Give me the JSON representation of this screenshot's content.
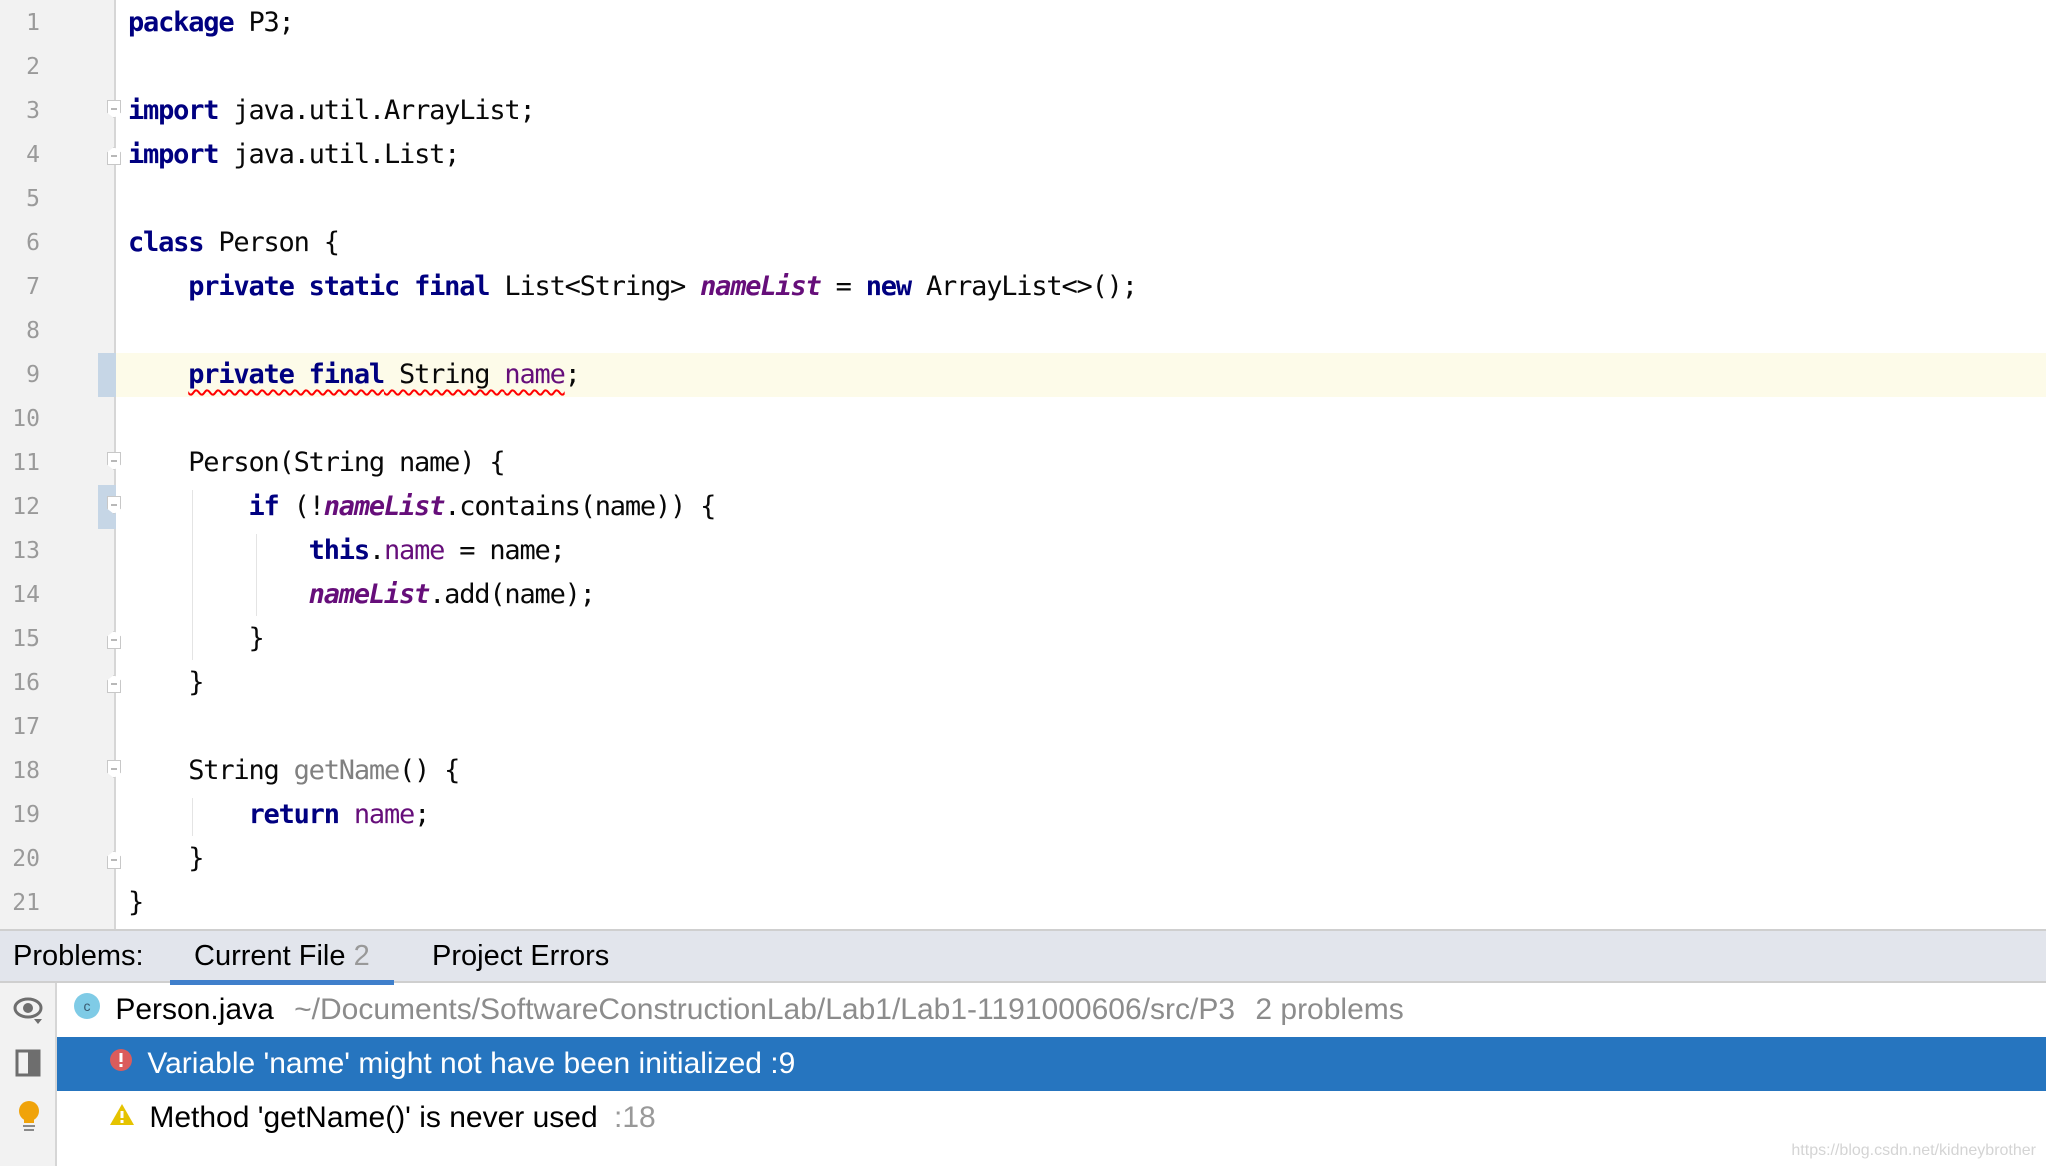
{
  "editor": {
    "current_line": 9,
    "lines": [
      {
        "n": "1",
        "tokens": [
          {
            "t": "package",
            "c": "kw"
          },
          {
            "t": " P3;"
          }
        ]
      },
      {
        "n": "2",
        "tokens": []
      },
      {
        "n": "3",
        "tokens": [
          {
            "t": "import",
            "c": "kw"
          },
          {
            "t": " java.util.ArrayList;"
          }
        ]
      },
      {
        "n": "4",
        "tokens": [
          {
            "t": "import",
            "c": "kw"
          },
          {
            "t": " java.util.List;"
          }
        ]
      },
      {
        "n": "5",
        "tokens": []
      },
      {
        "n": "6",
        "tokens": [
          {
            "t": "class",
            "c": "kw"
          },
          {
            "t": " Person {"
          }
        ]
      },
      {
        "n": "7",
        "tokens": [
          {
            "t": "    "
          },
          {
            "t": "private static final",
            "c": "kw"
          },
          {
            "t": " List<String> "
          },
          {
            "t": "nameList",
            "c": "sfld"
          },
          {
            "t": " = "
          },
          {
            "t": "new",
            "c": "kw"
          },
          {
            "t": " ArrayList<>();"
          }
        ]
      },
      {
        "n": "8",
        "tokens": []
      },
      {
        "n": "9",
        "tokens": [
          {
            "t": "    "
          },
          {
            "t": "private final",
            "c": "kw err"
          },
          {
            "t": " String ",
            "c": "err"
          },
          {
            "t": "name",
            "c": "fld err"
          },
          {
            "t": ";"
          }
        ]
      },
      {
        "n": "10",
        "tokens": []
      },
      {
        "n": "11",
        "tokens": [
          {
            "t": "    Person(String name) {"
          }
        ]
      },
      {
        "n": "12",
        "tokens": [
          {
            "t": "        "
          },
          {
            "t": "if",
            "c": "kw"
          },
          {
            "t": " (!"
          },
          {
            "t": "nameList",
            "c": "sfld"
          },
          {
            "t": ".contains(name)) {"
          }
        ]
      },
      {
        "n": "13",
        "tokens": [
          {
            "t": "            "
          },
          {
            "t": "this",
            "c": "kw"
          },
          {
            "t": "."
          },
          {
            "t": "name",
            "c": "fld"
          },
          {
            "t": " = name;"
          }
        ]
      },
      {
        "n": "14",
        "tokens": [
          {
            "t": "            "
          },
          {
            "t": "nameList",
            "c": "sfld"
          },
          {
            "t": ".add(name);"
          }
        ]
      },
      {
        "n": "15",
        "tokens": [
          {
            "t": "        }"
          }
        ]
      },
      {
        "n": "16",
        "tokens": [
          {
            "t": "    }"
          }
        ]
      },
      {
        "n": "17",
        "tokens": []
      },
      {
        "n": "18",
        "tokens": [
          {
            "t": "    String "
          },
          {
            "t": "getName",
            "c": "unused"
          },
          {
            "t": "() {"
          }
        ]
      },
      {
        "n": "19",
        "tokens": [
          {
            "t": "        "
          },
          {
            "t": "return",
            "c": "kw"
          },
          {
            "t": " "
          },
          {
            "t": "name",
            "c": "fld"
          },
          {
            "t": ";"
          }
        ]
      },
      {
        "n": "20",
        "tokens": [
          {
            "t": "    }"
          }
        ]
      },
      {
        "n": "21",
        "tokens": [
          {
            "t": "}"
          }
        ]
      }
    ]
  },
  "problems": {
    "label": "Problems:",
    "tabs": [
      {
        "label": "Current File",
        "count": "2",
        "active": true
      },
      {
        "label": "Project Errors",
        "count": "",
        "active": false
      }
    ],
    "file": {
      "name": "Person.java",
      "icon": "class-icon",
      "path": "~/Documents/SoftwareConstructionLab/Lab1/Lab1-1191000606/src/P3",
      "summary": "2 problems"
    },
    "items": [
      {
        "severity": "error",
        "icon": "error-icon",
        "message": "Variable 'name' might not have been initialized",
        "location": ":9",
        "selected": true
      },
      {
        "severity": "warning",
        "icon": "warning-icon",
        "message": "Method 'getName()' is never used",
        "location": ":18",
        "selected": false
      }
    ],
    "tools": [
      "eye-icon",
      "preview-panel-icon",
      "lightbulb-icon"
    ]
  },
  "colors": {
    "selection": "#2675bf",
    "tab_underline": "#3f7fcb",
    "keyword": "#000080",
    "field": "#660e7a",
    "error": "#db5c5c",
    "warning": "#e5c300",
    "bulb": "#f0a30a"
  },
  "watermark": "https://blog.csdn.net/kidneybrother"
}
